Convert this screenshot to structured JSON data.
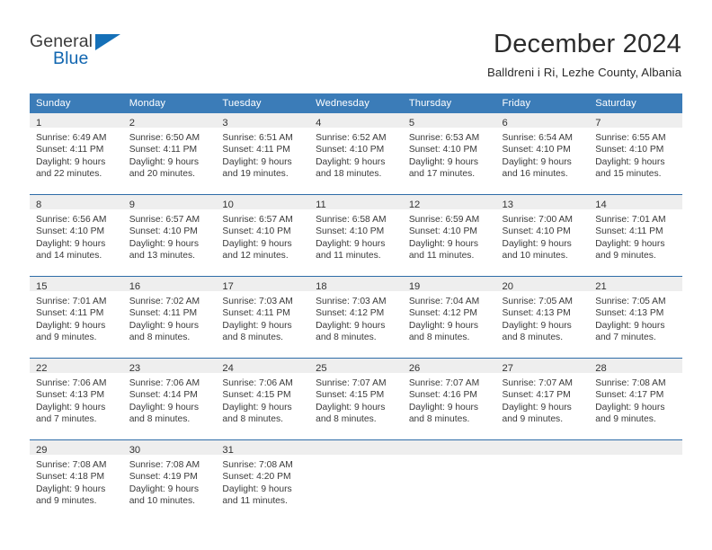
{
  "brand": {
    "name_top": "General",
    "name_bottom": "Blue",
    "accent_color": "#1570b8",
    "triangle_icon": "triangle-logo-icon"
  },
  "header": {
    "title": "December 2024",
    "subtitle": "Balldreni i Ri, Lezhe County, Albania"
  },
  "theme": {
    "header_row_bg": "#3b7cb8",
    "header_row_text": "#ffffff",
    "row_separator": "#2f6da8",
    "daynum_band_bg": "#eeeeee",
    "body_text": "#3a3a3a"
  },
  "calendar": {
    "weekday_headers": [
      "Sunday",
      "Monday",
      "Tuesday",
      "Wednesday",
      "Thursday",
      "Friday",
      "Saturday"
    ],
    "weeks": [
      [
        {
          "day": "1",
          "lines": [
            "Sunrise: 6:49 AM",
            "Sunset: 4:11 PM",
            "Daylight: 9 hours",
            "and 22 minutes."
          ]
        },
        {
          "day": "2",
          "lines": [
            "Sunrise: 6:50 AM",
            "Sunset: 4:11 PM",
            "Daylight: 9 hours",
            "and 20 minutes."
          ]
        },
        {
          "day": "3",
          "lines": [
            "Sunrise: 6:51 AM",
            "Sunset: 4:11 PM",
            "Daylight: 9 hours",
            "and 19 minutes."
          ]
        },
        {
          "day": "4",
          "lines": [
            "Sunrise: 6:52 AM",
            "Sunset: 4:10 PM",
            "Daylight: 9 hours",
            "and 18 minutes."
          ]
        },
        {
          "day": "5",
          "lines": [
            "Sunrise: 6:53 AM",
            "Sunset: 4:10 PM",
            "Daylight: 9 hours",
            "and 17 minutes."
          ]
        },
        {
          "day": "6",
          "lines": [
            "Sunrise: 6:54 AM",
            "Sunset: 4:10 PM",
            "Daylight: 9 hours",
            "and 16 minutes."
          ]
        },
        {
          "day": "7",
          "lines": [
            "Sunrise: 6:55 AM",
            "Sunset: 4:10 PM",
            "Daylight: 9 hours",
            "and 15 minutes."
          ]
        }
      ],
      [
        {
          "day": "8",
          "lines": [
            "Sunrise: 6:56 AM",
            "Sunset: 4:10 PM",
            "Daylight: 9 hours",
            "and 14 minutes."
          ]
        },
        {
          "day": "9",
          "lines": [
            "Sunrise: 6:57 AM",
            "Sunset: 4:10 PM",
            "Daylight: 9 hours",
            "and 13 minutes."
          ]
        },
        {
          "day": "10",
          "lines": [
            "Sunrise: 6:57 AM",
            "Sunset: 4:10 PM",
            "Daylight: 9 hours",
            "and 12 minutes."
          ]
        },
        {
          "day": "11",
          "lines": [
            "Sunrise: 6:58 AM",
            "Sunset: 4:10 PM",
            "Daylight: 9 hours",
            "and 11 minutes."
          ]
        },
        {
          "day": "12",
          "lines": [
            "Sunrise: 6:59 AM",
            "Sunset: 4:10 PM",
            "Daylight: 9 hours",
            "and 11 minutes."
          ]
        },
        {
          "day": "13",
          "lines": [
            "Sunrise: 7:00 AM",
            "Sunset: 4:10 PM",
            "Daylight: 9 hours",
            "and 10 minutes."
          ]
        },
        {
          "day": "14",
          "lines": [
            "Sunrise: 7:01 AM",
            "Sunset: 4:11 PM",
            "Daylight: 9 hours",
            "and 9 minutes."
          ]
        }
      ],
      [
        {
          "day": "15",
          "lines": [
            "Sunrise: 7:01 AM",
            "Sunset: 4:11 PM",
            "Daylight: 9 hours",
            "and 9 minutes."
          ]
        },
        {
          "day": "16",
          "lines": [
            "Sunrise: 7:02 AM",
            "Sunset: 4:11 PM",
            "Daylight: 9 hours",
            "and 8 minutes."
          ]
        },
        {
          "day": "17",
          "lines": [
            "Sunrise: 7:03 AM",
            "Sunset: 4:11 PM",
            "Daylight: 9 hours",
            "and 8 minutes."
          ]
        },
        {
          "day": "18",
          "lines": [
            "Sunrise: 7:03 AM",
            "Sunset: 4:12 PM",
            "Daylight: 9 hours",
            "and 8 minutes."
          ]
        },
        {
          "day": "19",
          "lines": [
            "Sunrise: 7:04 AM",
            "Sunset: 4:12 PM",
            "Daylight: 9 hours",
            "and 8 minutes."
          ]
        },
        {
          "day": "20",
          "lines": [
            "Sunrise: 7:05 AM",
            "Sunset: 4:13 PM",
            "Daylight: 9 hours",
            "and 8 minutes."
          ]
        },
        {
          "day": "21",
          "lines": [
            "Sunrise: 7:05 AM",
            "Sunset: 4:13 PM",
            "Daylight: 9 hours",
            "and 7 minutes."
          ]
        }
      ],
      [
        {
          "day": "22",
          "lines": [
            "Sunrise: 7:06 AM",
            "Sunset: 4:13 PM",
            "Daylight: 9 hours",
            "and 7 minutes."
          ]
        },
        {
          "day": "23",
          "lines": [
            "Sunrise: 7:06 AM",
            "Sunset: 4:14 PM",
            "Daylight: 9 hours",
            "and 8 minutes."
          ]
        },
        {
          "day": "24",
          "lines": [
            "Sunrise: 7:06 AM",
            "Sunset: 4:15 PM",
            "Daylight: 9 hours",
            "and 8 minutes."
          ]
        },
        {
          "day": "25",
          "lines": [
            "Sunrise: 7:07 AM",
            "Sunset: 4:15 PM",
            "Daylight: 9 hours",
            "and 8 minutes."
          ]
        },
        {
          "day": "26",
          "lines": [
            "Sunrise: 7:07 AM",
            "Sunset: 4:16 PM",
            "Daylight: 9 hours",
            "and 8 minutes."
          ]
        },
        {
          "day": "27",
          "lines": [
            "Sunrise: 7:07 AM",
            "Sunset: 4:17 PM",
            "Daylight: 9 hours",
            "and 9 minutes."
          ]
        },
        {
          "day": "28",
          "lines": [
            "Sunrise: 7:08 AM",
            "Sunset: 4:17 PM",
            "Daylight: 9 hours",
            "and 9 minutes."
          ]
        }
      ],
      [
        {
          "day": "29",
          "lines": [
            "Sunrise: 7:08 AM",
            "Sunset: 4:18 PM",
            "Daylight: 9 hours",
            "and 9 minutes."
          ]
        },
        {
          "day": "30",
          "lines": [
            "Sunrise: 7:08 AM",
            "Sunset: 4:19 PM",
            "Daylight: 9 hours",
            "and 10 minutes."
          ]
        },
        {
          "day": "31",
          "lines": [
            "Sunrise: 7:08 AM",
            "Sunset: 4:20 PM",
            "Daylight: 9 hours",
            "and 11 minutes."
          ]
        },
        {
          "day": "",
          "lines": []
        },
        {
          "day": "",
          "lines": []
        },
        {
          "day": "",
          "lines": []
        },
        {
          "day": "",
          "lines": []
        }
      ]
    ]
  }
}
